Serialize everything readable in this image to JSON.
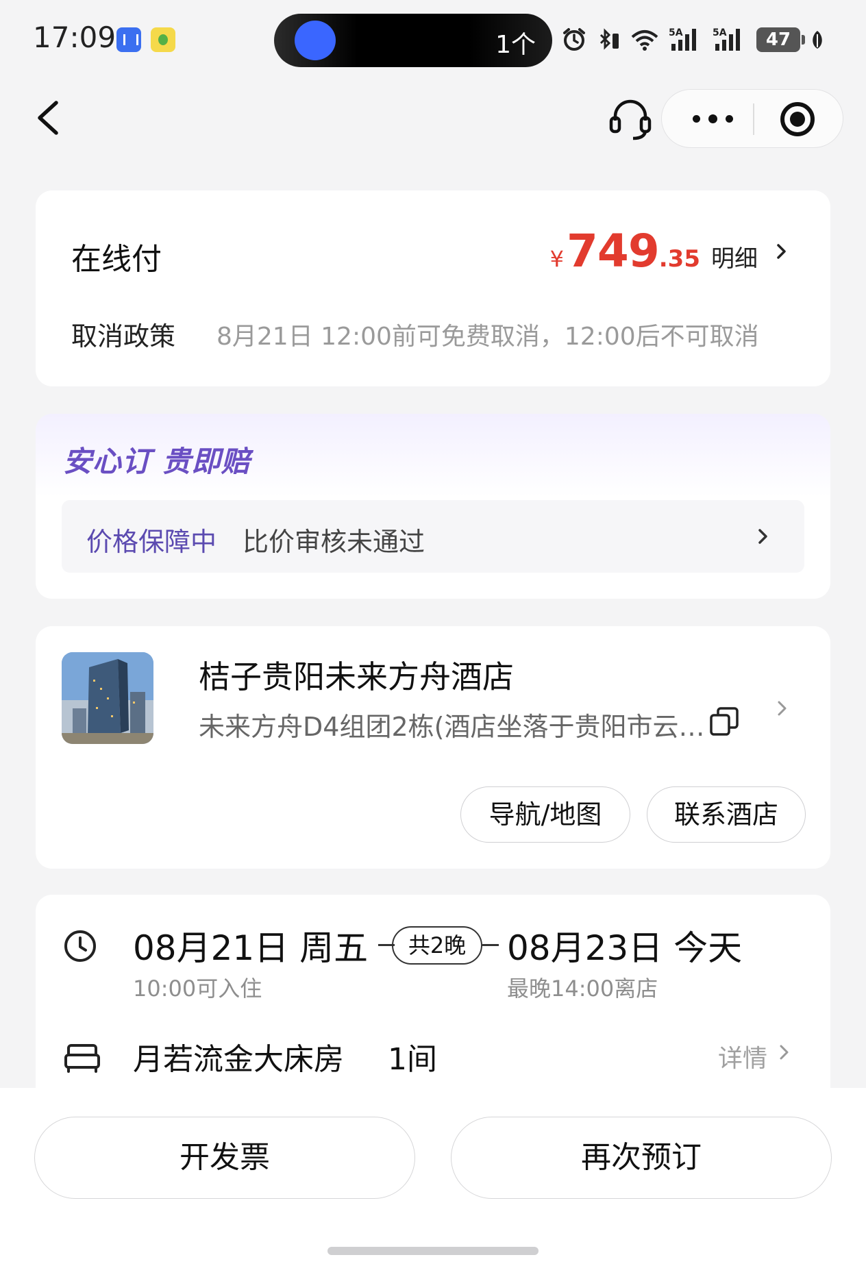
{
  "status_bar": {
    "time": "17:09",
    "island_text": "1个",
    "battery": "47",
    "icons": [
      "voice-app-icon",
      "music-app-icon",
      "alarm-icon",
      "bluetooth-icon",
      "wifi-icon",
      "signal-5g-icon",
      "signal-5g-icon",
      "battery-icon",
      "leaf-icon"
    ]
  },
  "nav": {
    "icons": [
      "back-icon",
      "customer-service-icon",
      "more-icon",
      "mini-program-close-icon"
    ]
  },
  "payment": {
    "title": "在线付",
    "currency": "¥",
    "price_int": "749",
    "price_dec": ".35",
    "detail_label": "明细",
    "cancel_label": "取消政策",
    "cancel_text": "8月21日 12:00前可免费取消，12:00后不可取消",
    "accent_color": "#e23b2e"
  },
  "guarantee": {
    "brand": "安心订 贵即赔",
    "status": "价格保障中",
    "result": "比价审核未通过",
    "accent_color": "#6a4fc3"
  },
  "hotel": {
    "name": "桔子贵阳未来方舟酒店",
    "address": "未来方舟D4组团2栋(酒店坐落于贵阳市云…",
    "nav_button": "导航/地图",
    "contact_button": "联系酒店"
  },
  "stay": {
    "checkin_date": "08月21日 周五",
    "checkin_note": "10:00可入住",
    "nights": "共2晚",
    "checkout_date": "08月23日 今天",
    "checkout_note": "最晚14:00离店",
    "room_name": "月若流金大床房",
    "room_count": "1间",
    "detail_label": "详情"
  },
  "bottom": {
    "invoice_button": "开发票",
    "rebook_button": "再次预订"
  }
}
